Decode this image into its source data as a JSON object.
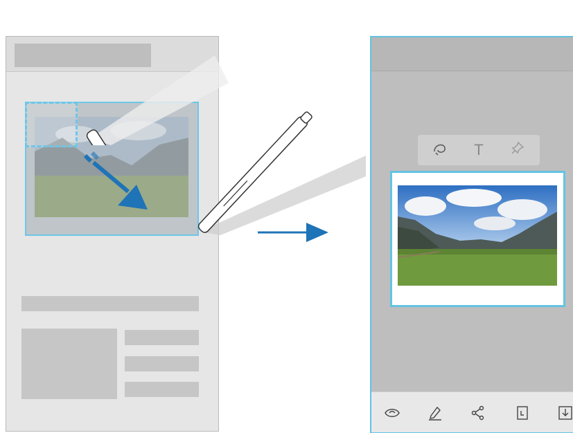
{
  "colors": {
    "accent": "#63c3e3",
    "arrow_blue": "#1f73b7",
    "placeholder_gray": "#c6c6c6"
  },
  "left_phone": {
    "selection_tool": "dashed-rectangle-selection",
    "arrow_icon": "drag-arrow-icon"
  },
  "right_phone": {
    "popup_icons": [
      "lasso-icon",
      "text-icon",
      "pin-icon"
    ],
    "bottom_bar_icons": [
      "eye-icon",
      "pen-icon",
      "share-icon",
      "crop-icon",
      "download-icon"
    ],
    "text_icon_glyph": "T"
  }
}
